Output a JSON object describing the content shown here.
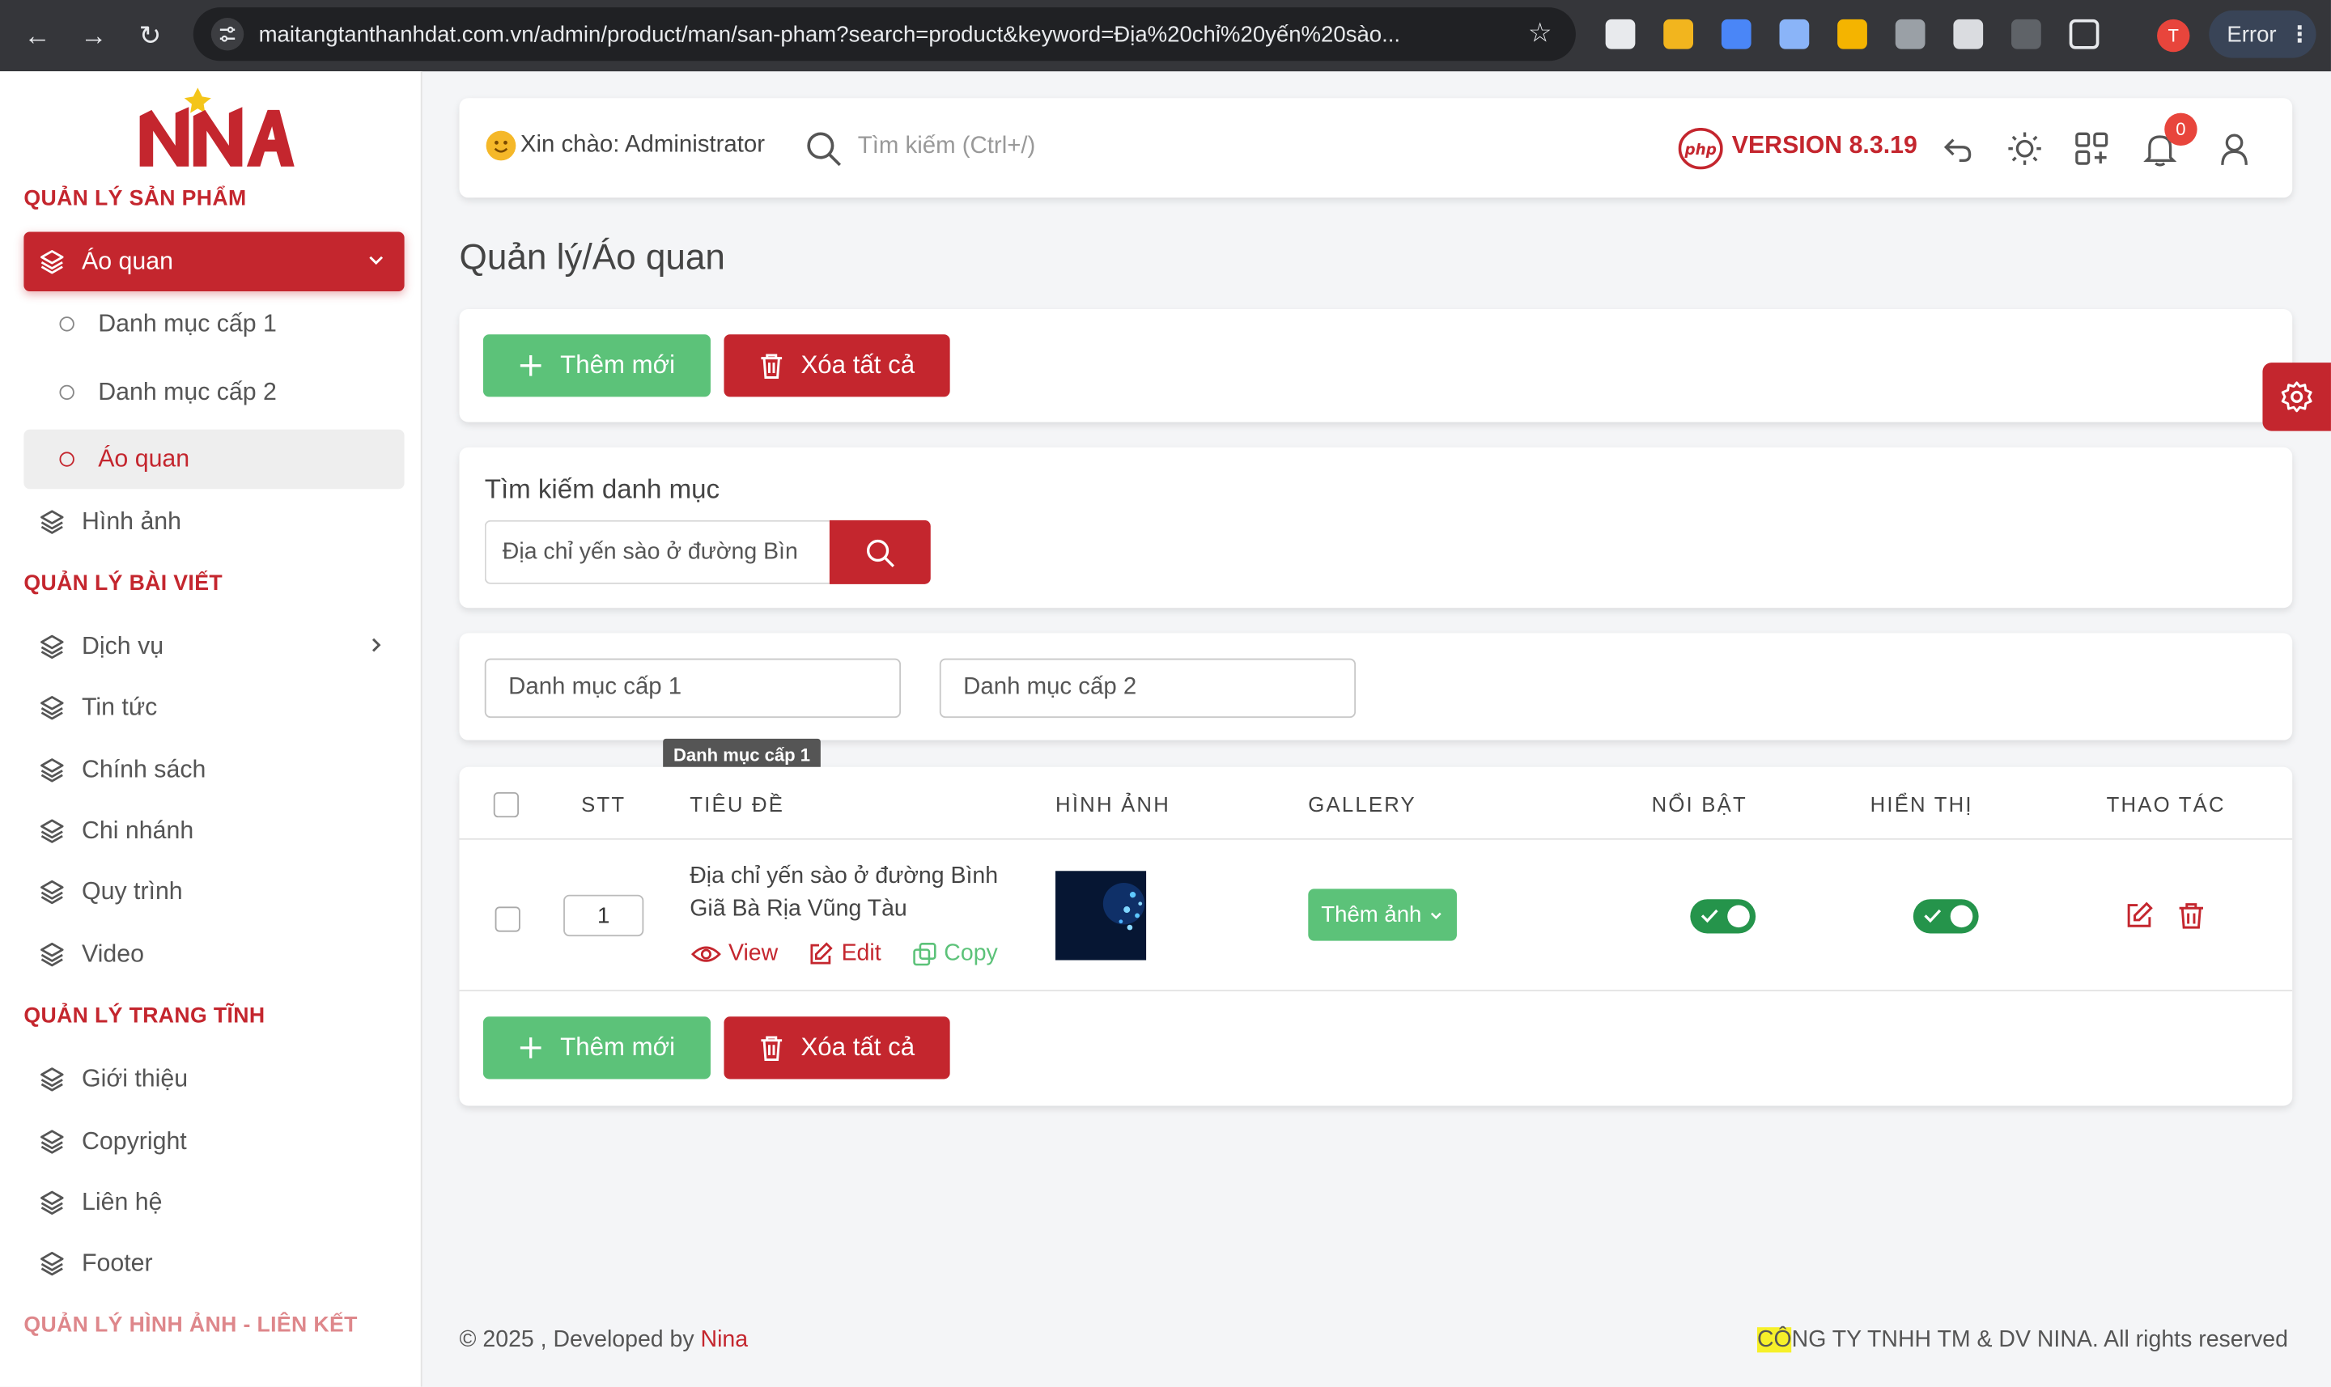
{
  "browser": {
    "url": "maitangtanthanhdat.com.vn/admin/product/man/san-pham?search=product&keyword=Địa%20chỉ%20yến%20sào...",
    "profile_initial": "T",
    "error_label": "Error"
  },
  "sidebar": {
    "sections": {
      "products": "QUẢN LÝ SẢN PHẨM",
      "articles": "QUẢN LÝ BÀI VIẾT",
      "static": "QUẢN LÝ TRANG TĨNH",
      "images": "QUẢN LÝ HÌNH ẢNH - LIÊN KẾT"
    },
    "active_item": "Áo quan",
    "sub_items": [
      "Danh mục cấp 1",
      "Danh mục cấp 2",
      "Áo quan"
    ],
    "image_item": "Hình ảnh",
    "article_items": [
      "Dịch vụ",
      "Tin tức",
      "Chính sách",
      "Chi nhánh",
      "Quy trình",
      "Video"
    ],
    "static_items": [
      "Giới thiệu",
      "Copyright",
      "Liên hệ",
      "Footer"
    ]
  },
  "header": {
    "greeting": "Xin chào: Administrator",
    "search_placeholder": "Tìm kiếm (Ctrl+/)",
    "version": "VERSION 8.3.19",
    "notification_count": "0"
  },
  "page": {
    "title": "Quản lý/Áo quan",
    "add_label": "Thêm mới",
    "delete_all_label": "Xóa tất cả"
  },
  "search": {
    "label": "Tìm kiếm danh mục",
    "value": "Địa chỉ yến sào ở đường Bìn"
  },
  "filters": {
    "level1": "Danh mục cấp 1",
    "level2": "Danh mục cấp 2",
    "tooltip": "Danh mục cấp 1"
  },
  "table": {
    "columns": [
      "STT",
      "TIÊU ĐỀ",
      "HÌNH ẢNH",
      "GALLERY",
      "NỔI BẬT",
      "HIỂN THỊ",
      "THAO TÁC"
    ],
    "rows": [
      {
        "stt": "1",
        "title": "Địa chỉ yến sào ở đường Bình Giã Bà Rịa Vũng Tàu",
        "view": "View",
        "edit": "Edit",
        "copy": "Copy",
        "gallery": "Thêm ảnh",
        "featured": true,
        "visible": true
      }
    ]
  },
  "footer": {
    "left_prefix": "© 2025 , Developed by ",
    "left_brand": "Nina",
    "right_highlight": "CÔ",
    "right_rest": "NG TY TNHH TM & DV NINA. All rights reserved"
  },
  "colors": {
    "brand_red": "#c4262e",
    "green": "#5cc279",
    "toggle_green": "#25944b"
  }
}
